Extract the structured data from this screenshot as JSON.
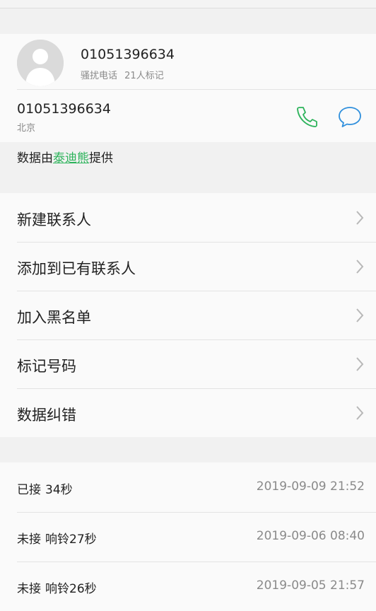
{
  "contact": {
    "name": "01051396634",
    "tag_type": "骚扰电话",
    "tag_count": "21人标记"
  },
  "number": {
    "value": "01051396634",
    "location": "北京"
  },
  "provider": {
    "prefix": "数据由",
    "name": "泰迪熊",
    "suffix": "提供"
  },
  "actions": [
    {
      "label": "新建联系人"
    },
    {
      "label": "添加到已有联系人"
    },
    {
      "label": "加入黑名单"
    },
    {
      "label": "标记号码"
    },
    {
      "label": "数据纠错"
    }
  ],
  "call_log": [
    {
      "status": "已接",
      "duration": "34秒",
      "time": "2019-09-09 21:52"
    },
    {
      "status": "未接",
      "duration": "响铃27秒",
      "time": "2019-09-06 08:40"
    },
    {
      "status": "未接",
      "duration": "响铃26秒",
      "time": "2019-09-05 21:57"
    }
  ],
  "colors": {
    "accent_green": "#2db35b",
    "accent_blue": "#2f8fdc"
  },
  "icons": {
    "avatar": "person-silhouette-icon",
    "call": "phone-icon",
    "message": "chat-bubble-icon",
    "chevron": "chevron-right-icon"
  }
}
